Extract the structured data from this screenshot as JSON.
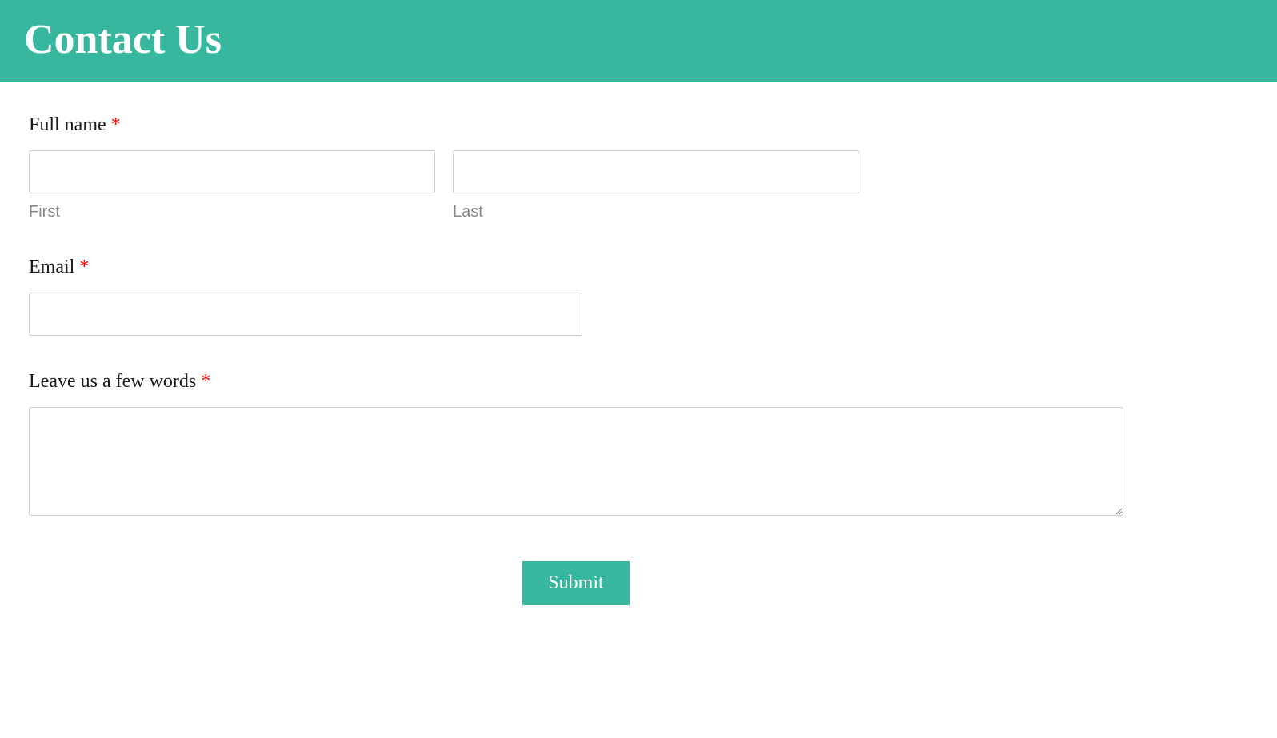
{
  "header": {
    "title": "Contact Us"
  },
  "form": {
    "full_name": {
      "label": "Full name ",
      "required": "*",
      "first_sublabel": "First",
      "last_sublabel": "Last",
      "first_value": "",
      "last_value": ""
    },
    "email": {
      "label": "Email ",
      "required": "*",
      "value": ""
    },
    "message": {
      "label": "Leave us a few words ",
      "required": "*",
      "value": ""
    },
    "submit_label": "Submit"
  },
  "colors": {
    "accent": "#36b79e",
    "required_marker": "#fa0000"
  }
}
